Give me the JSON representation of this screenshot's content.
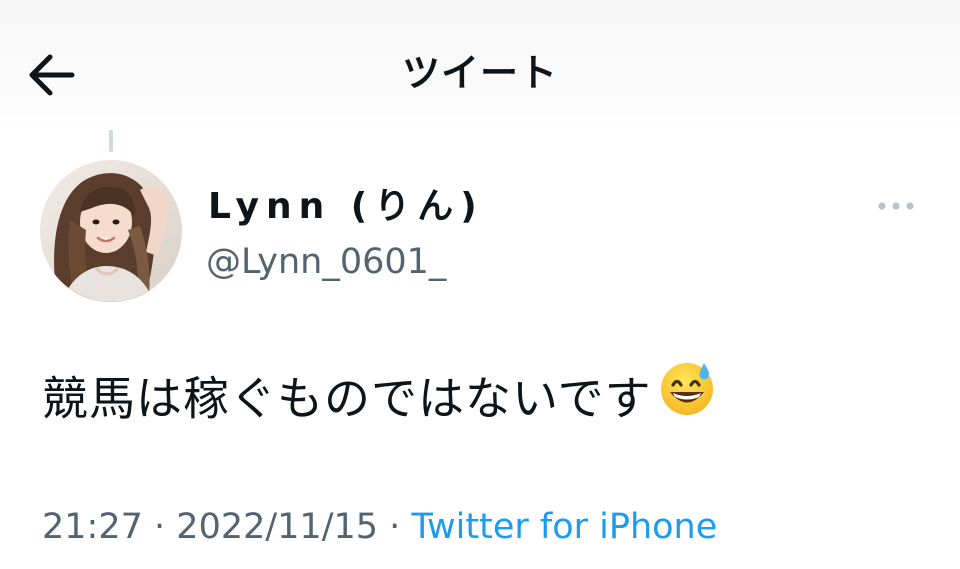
{
  "header": {
    "title": "ツイート",
    "back_icon": "arrow-left-icon"
  },
  "tweet": {
    "author": {
      "display_name": "Lynn (りん)",
      "handle": "@Lynn_0601_",
      "avatar_icon": "profile-photo"
    },
    "more_icon": "more-horizontal-icon",
    "text": "競馬は稼ぐものではないです",
    "emoji_icon": "grinning-face-with-sweat-emoji",
    "time": "21:27",
    "separator": "·",
    "date": "2022/11/15",
    "source": "Twitter for iPhone"
  },
  "colors": {
    "text_primary": "#0f1419",
    "text_secondary": "#536471",
    "link": "#1d9bf0",
    "icon_muted": "#b9c3cc",
    "thread_line": "#cfd9de"
  }
}
